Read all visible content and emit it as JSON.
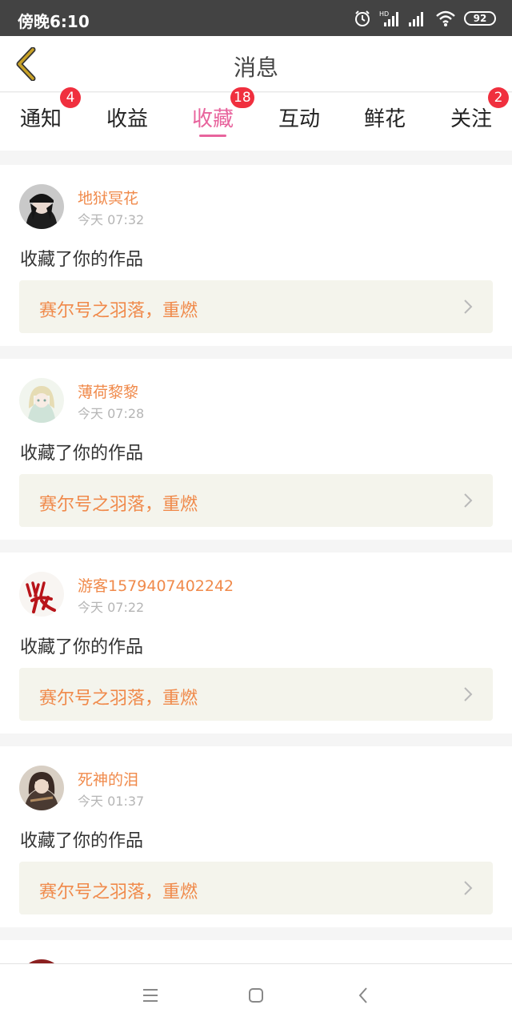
{
  "status_bar": {
    "time": "傍晚6:10",
    "battery": "92",
    "icons": [
      "alarm-icon",
      "hd-signal-icon",
      "signal-icon",
      "wifi-icon",
      "battery-icon"
    ]
  },
  "header": {
    "title": "消息",
    "back_icon": "chevron-left-icon"
  },
  "tabs": [
    {
      "label": "通知",
      "badge": "4",
      "active": false
    },
    {
      "label": "收益",
      "badge": null,
      "active": false
    },
    {
      "label": "收藏",
      "badge": "18",
      "active": true
    },
    {
      "label": "互动",
      "badge": null,
      "active": false
    },
    {
      "label": "鲜花",
      "badge": null,
      "active": false
    },
    {
      "label": "关注",
      "badge": "2",
      "active": false
    }
  ],
  "messages": [
    {
      "user": "地狱冥花",
      "time": "今天 07:32",
      "action": "收藏了你的作品",
      "work": "赛尔号之羽落，重燃"
    },
    {
      "user": "薄荷黎黎",
      "time": "今天 07:28",
      "action": "收藏了你的作品",
      "work": "赛尔号之羽落，重燃"
    },
    {
      "user": "游客1579407402242",
      "time": "今天 07:22",
      "action": "收藏了你的作品",
      "work": "赛尔号之羽落，重燃"
    },
    {
      "user": "死神的泪",
      "time": "今天 01:37",
      "action": "收藏了你的作品",
      "work": "赛尔号之羽落，重燃"
    }
  ],
  "colors": {
    "accent": "#e8649d",
    "username": "#f08a4b",
    "badge": "#f02f3e",
    "work_bg": "#f4f4ec",
    "back_icon": "#c9a227"
  },
  "nav_bar": {
    "icons": [
      "menu-icon",
      "home-icon",
      "back-icon"
    ]
  }
}
